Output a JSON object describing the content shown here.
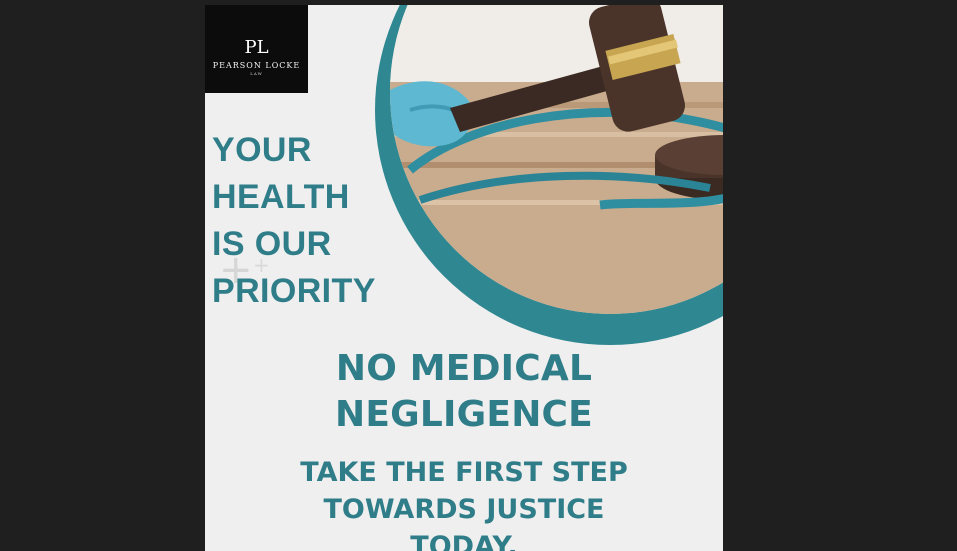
{
  "logo": {
    "monogram": "PL",
    "name": "PEARSON LOCKE",
    "sub": "LAW"
  },
  "headline": {
    "lines": [
      "YOUR",
      "HEALTH",
      "IS OUR",
      "PRIORITY"
    ]
  },
  "subheadline": {
    "lines": [
      "NO MEDICAL",
      "NEGLIGENCE"
    ]
  },
  "cta": {
    "lines": [
      "TAKE THE FIRST STEP",
      "TOWARDS JUSTICE",
      "TODAY."
    ]
  },
  "colors": {
    "background": "#1f1f1f",
    "poster": "#efefef",
    "teal": "#2f8791",
    "text_teal": "#2f7d88",
    "logo_bg": "#0c0c0c"
  },
  "icons": {
    "decor": "plus-icon"
  }
}
